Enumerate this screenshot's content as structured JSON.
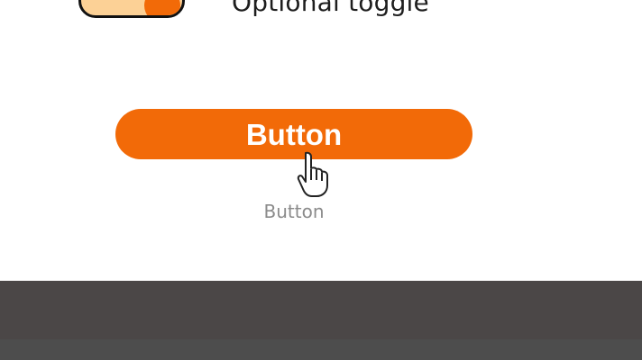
{
  "toggle": {
    "label": "Optional toggle",
    "state": "on",
    "colors": {
      "track": "#FCD196",
      "knob": "#F26A08",
      "border": "#111111"
    }
  },
  "primary_button": {
    "label": "Button",
    "color": "#F26A08",
    "text_color": "#FFFFFF"
  },
  "caption": {
    "text": "Button"
  },
  "cursor": {
    "icon": "hand-pointer-icon"
  },
  "footer": {
    "colors": [
      "#4B4747",
      "#4D4D4D"
    ]
  }
}
